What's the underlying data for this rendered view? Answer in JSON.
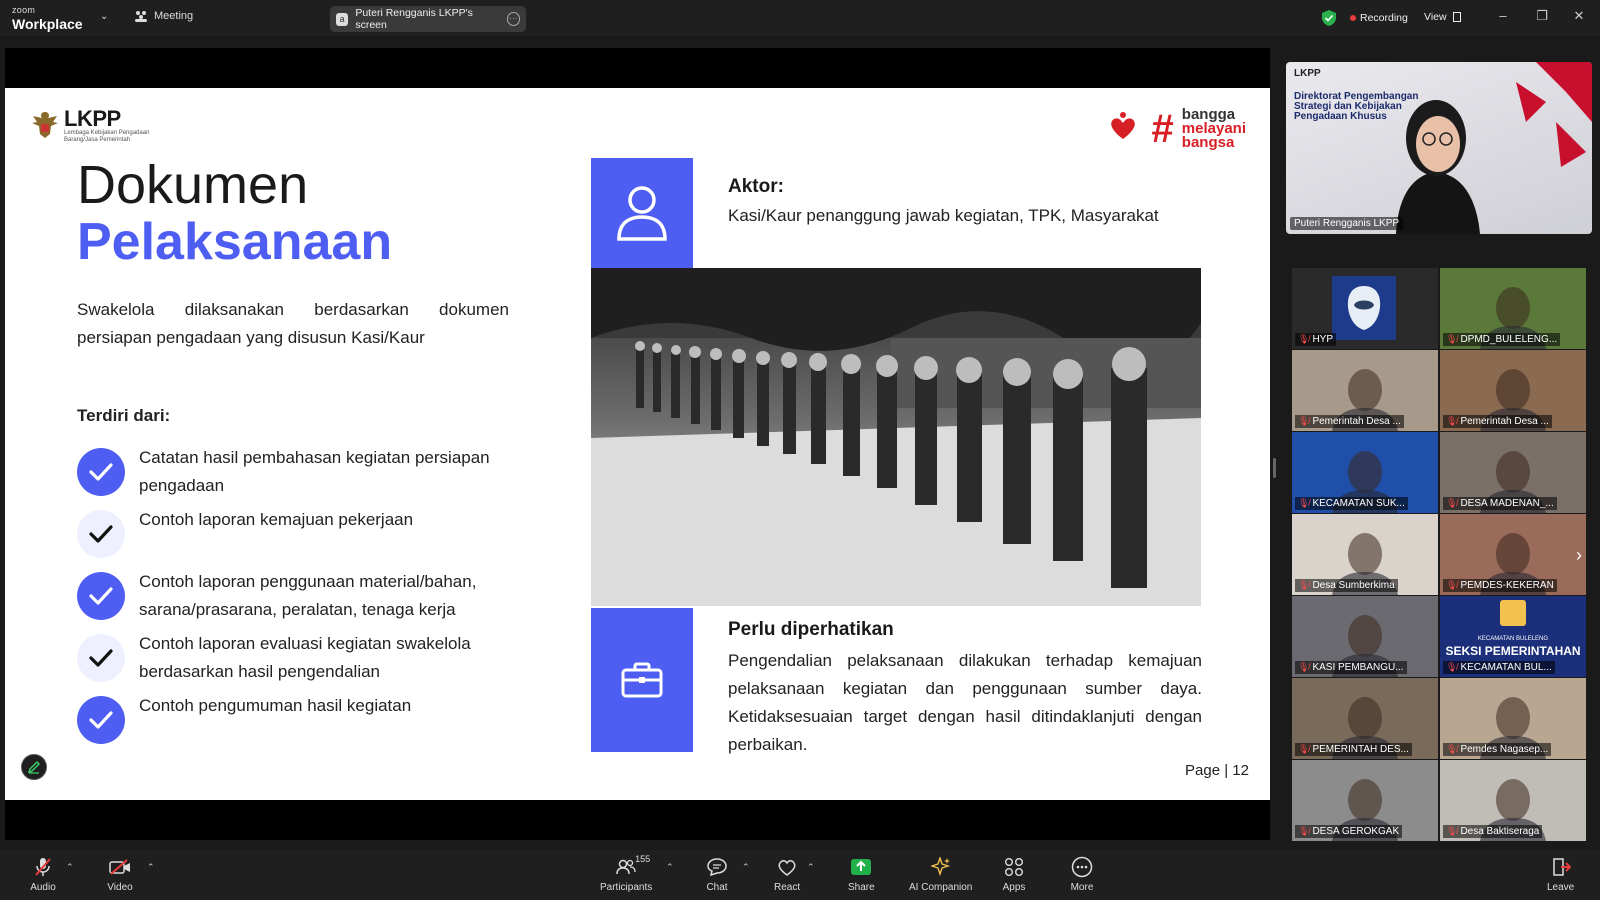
{
  "topbar": {
    "brand_small": "zoom",
    "brand_name": "Workplace",
    "meeting_label": "Meeting",
    "share_label": "Puteri Rengganis LKPP's screen",
    "recording_label": "Recording",
    "view_label": "View"
  },
  "slide": {
    "logo_word": "LKPP",
    "logo_sub": "Lembaga Kebijakan Pengadaan Barang/Jasa Pemerintah",
    "campaign": [
      "bangga",
      "melayani",
      "bangsa"
    ],
    "title_line1": "Dokumen",
    "title_line2": "Pelaksanaan",
    "lead": "Swakelola dilaksanakan berdasarkan dokumen persiapan pengadaan yang disusun Kasi/Kaur",
    "terdiri": "Terdiri dari:",
    "checklist": [
      {
        "text": "Catatan hasil pembahasan kegiatan persiapan pengadaan",
        "style": "filled"
      },
      {
        "text": "Contoh laporan kemajuan pekerjaan",
        "style": "light"
      },
      {
        "text": "Contoh laporan penggunaan material/bahan, sarana/prasarana, peralatan, tenaga kerja",
        "style": "filled"
      },
      {
        "text": "Contoh laporan evaluasi kegiatan swakelola berdasarkan hasil pengendalian",
        "style": "light"
      },
      {
        "text": "Contoh pengumuman hasil kegiatan",
        "style": "filled"
      }
    ],
    "aktor_title": "Aktor:",
    "aktor_text": "Kasi/Kaur penanggung jawab kegiatan, TPK, Masyarakat",
    "perlu_title": "Perlu diperhatikan",
    "perlu_text": "Pengendalian pelaksanaan dilakukan terhadap kemajuan pelaksanaan kegiatan dan penggunaan sumber daya. Ketidaksesuaian target dengan hasil ditindaklanjuti dengan perbaikan.",
    "page": "Page | 12",
    "accent": "#4f5ef2"
  },
  "speaker": {
    "logo": "LKPP",
    "title": "Direktorat Pengembangan Strategi dan Kebijakan Pengadaan Khusus",
    "name": "Puteri Rengganis LKPP"
  },
  "gallery": [
    {
      "name": "HYP",
      "bg": "#2a2a2a"
    },
    {
      "name": "DPMD_BULELENG...",
      "bg": "#5b7a3a"
    },
    {
      "name": "Pemerintah Desa ...",
      "bg": "#a89a8a"
    },
    {
      "name": "Pemerintah Desa ...",
      "bg": "#8a6a50"
    },
    {
      "name": "KECAMATAN SUK...",
      "bg": "#1f4fa8"
    },
    {
      "name": "DESA MADENAN_...",
      "bg": "#7a7068"
    },
    {
      "name": "Desa Sumberkima",
      "bg": "#d9d3cc"
    },
    {
      "name": "PEMDES-KEKERAN",
      "bg": "#9a6a5a"
    },
    {
      "name": "KASI PEMBANGU...",
      "bg": "#6a6a70"
    },
    {
      "name": "KECAMATAN BUL...",
      "bg": "#1c2f7a",
      "caption_top": "KECAMATAN BULELENG",
      "caption_main": "SEKSI PEMERINTAHAN"
    },
    {
      "name": "PEMERINTAH DES...",
      "bg": "#7a6a5a"
    },
    {
      "name": "Pemdes Nagasep...",
      "bg": "#b8a690"
    },
    {
      "name": "DESA GEROKGAK",
      "bg": "#8c8c8c"
    },
    {
      "name": "Desa Baktiseraga",
      "bg": "#c0bcb6"
    }
  ],
  "toolbar": {
    "audio": "Audio",
    "video": "Video",
    "participants": "Participants",
    "participants_count": "155",
    "chat": "Chat",
    "react": "React",
    "share": "Share",
    "ai": "AI Companion",
    "apps": "Apps",
    "more": "More",
    "leave": "Leave"
  }
}
